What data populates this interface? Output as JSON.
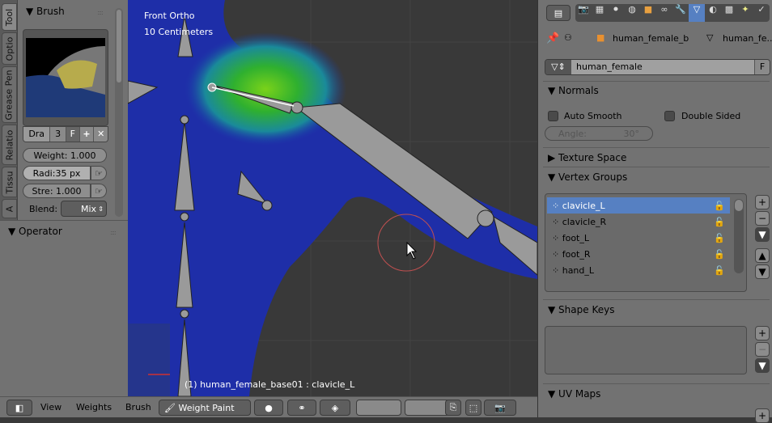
{
  "toolshelf": {
    "tabs": [
      "Tool",
      "Optio",
      "Grease Pen",
      "Relatio",
      "Tissu",
      "A"
    ],
    "brush_panel": "Brush",
    "brush_name": "Dra",
    "brush_users": "3",
    "fake_user": "F",
    "weight": "Weight:  1.000",
    "radius": "Radi:35 px",
    "strength": "Stre: 1.000",
    "blend_label": "Blend:",
    "blend_value": "Mix"
  },
  "operator_panel": "Operator",
  "viewport": {
    "view_name": "Front Ortho",
    "scale": "10 Centimeters",
    "status": "(1) human_female_base01 : clavicle_L",
    "colors": {
      "body": "#1a2a9a",
      "hot": "#2fb02f",
      "bg": "#393939"
    }
  },
  "header": {
    "menus": [
      "View",
      "Weights",
      "Brush"
    ],
    "mode": "Weight Paint"
  },
  "props": {
    "breadcrumb": [
      "human_female_b",
      "human_fe..."
    ],
    "mesh_name": "human_female",
    "fake_user": "F",
    "normals": {
      "title": "Normals",
      "auto_smooth": "Auto Smooth",
      "double_sided": "Double Sided",
      "angle_label": "Angle:",
      "angle_value": "30°"
    },
    "texture_space": "Texture Space",
    "vertex_groups": {
      "title": "Vertex Groups",
      "items": [
        "clavicle_L",
        "clavicle_R",
        "foot_L",
        "foot_R",
        "hand_L"
      ],
      "selected": "clavicle_L"
    },
    "shape_keys": "Shape Keys",
    "uv_maps": "UV Maps",
    "accent": "#5680c2"
  }
}
